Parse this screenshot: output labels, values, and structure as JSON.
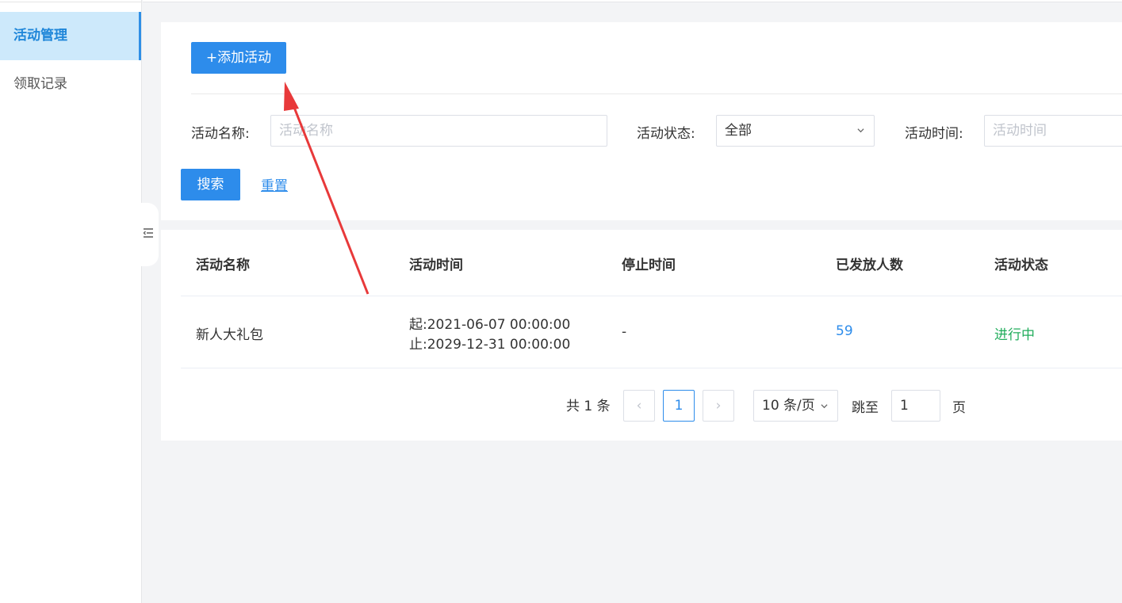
{
  "sidebar": {
    "items": [
      {
        "label": "活动管理",
        "active": true
      },
      {
        "label": "领取记录",
        "active": false
      }
    ]
  },
  "toolbar": {
    "add_label": "+添加活动"
  },
  "filters": {
    "name_label": "活动名称:",
    "name_placeholder": "活动名称",
    "status_label": "活动状态:",
    "status_value": "全部",
    "time_label": "活动时间:",
    "time_placeholder": "活动时间",
    "search_label": "搜索",
    "reset_label": "重置"
  },
  "table": {
    "headers": [
      "活动名称",
      "活动时间",
      "停止时间",
      "已发放人数",
      "活动状态"
    ],
    "rows": [
      {
        "name": "新人大礼包",
        "start": "起:2021-06-07 00:00:00",
        "end": "止:2029-12-31 00:00:00",
        "stop": "-",
        "issued": "59",
        "status": "进行中"
      }
    ]
  },
  "pagination": {
    "total_text": "共 1 条",
    "prev": "‹",
    "current": "1",
    "next": "›",
    "page_size": "10 条/页",
    "jump_label": "跳至",
    "jump_value": "1",
    "page_suffix": "页"
  },
  "colors": {
    "accent": "#2d8ceb",
    "success": "#22ad5c",
    "annotation": "#e8393a"
  },
  "icons": {
    "collapse": "collapse-menu-icon",
    "chevron": "chevron-down-icon"
  }
}
